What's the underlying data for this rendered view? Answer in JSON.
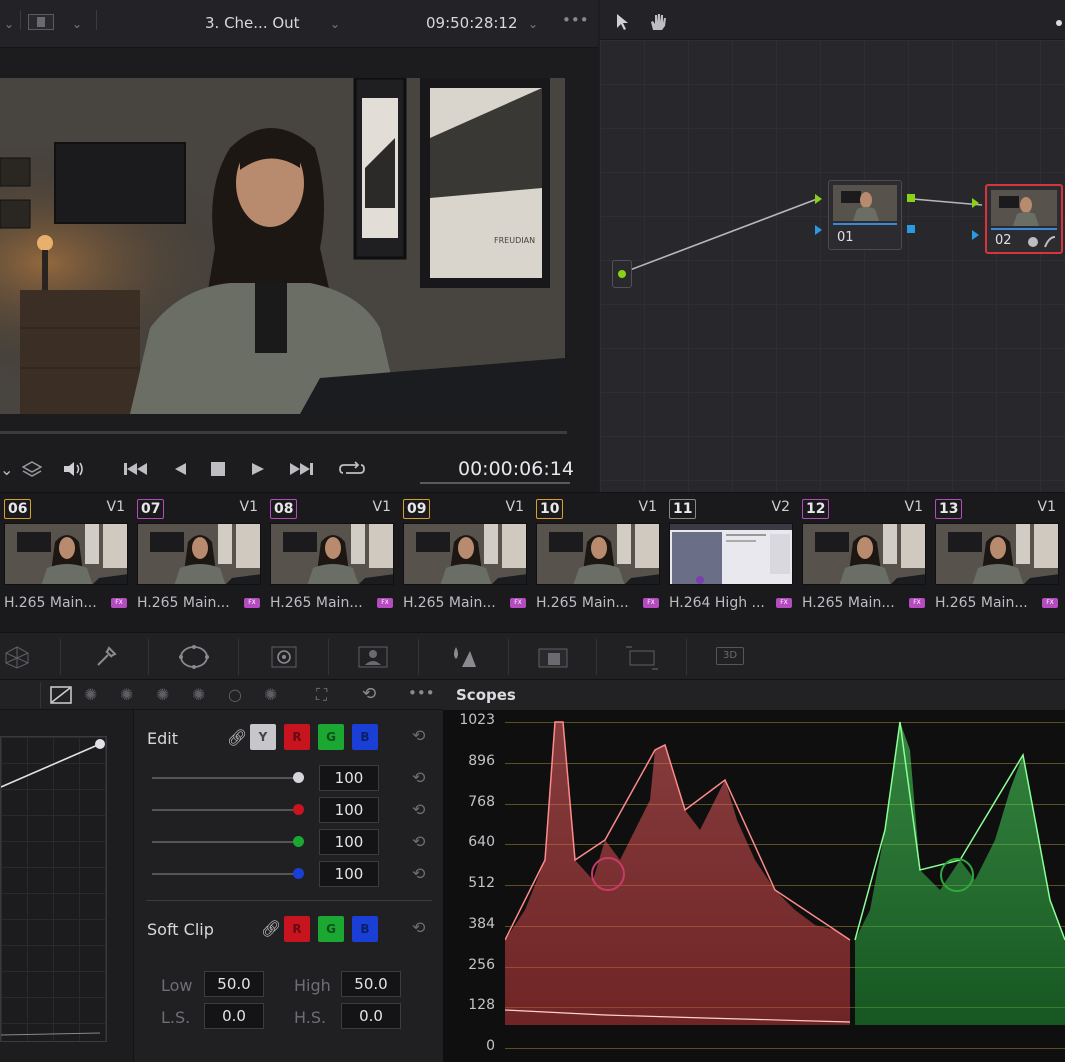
{
  "viewer": {
    "clip_name": "3. Che... Out",
    "timecode_top": "09:50:28:12",
    "more": "•••",
    "timecode": "00:00:06:14"
  },
  "nodes": [
    {
      "label": "01"
    },
    {
      "label": "02"
    }
  ],
  "clips": [
    {
      "num": "06",
      "track": "V1",
      "codec": "H.265 Main...",
      "color": "#d9a12a"
    },
    {
      "num": "07",
      "track": "V1",
      "codec": "H.265 Main...",
      "color": "#b44cc0"
    },
    {
      "num": "08",
      "track": "V1",
      "codec": "H.265 Main...",
      "color": "#b44cc0"
    },
    {
      "num": "09",
      "track": "V1",
      "codec": "H.265 Main...",
      "color": "#d9a12a"
    },
    {
      "num": "10",
      "track": "V1",
      "codec": "H.265 Main...",
      "color": "#d9a12a"
    },
    {
      "num": "11",
      "track": "V2",
      "codec": "H.264 High ...",
      "color": "#888888"
    },
    {
      "num": "12",
      "track": "V1",
      "codec": "H.265 Main...",
      "color": "#b44cc0"
    },
    {
      "num": "13",
      "track": "V1",
      "codec": "H.265 Main...",
      "color": "#b44cc0"
    }
  ],
  "fx_badge": "FX",
  "curves": {
    "edit_label": "Edit",
    "channels": [
      "Y",
      "R",
      "G",
      "B"
    ],
    "values": [
      "100",
      "100",
      "100",
      "100"
    ],
    "soft_clip_label": "Soft Clip",
    "soft_channels": [
      "R",
      "G",
      "B"
    ],
    "low_label": "Low",
    "low_value": "50.0",
    "high_label": "High",
    "high_value": "50.0",
    "ls_label": "L.S.",
    "ls_value": "0.0",
    "hs_label": "H.S.",
    "hs_value": "0.0"
  },
  "scopes": {
    "title": "Scopes",
    "scale": [
      "1023",
      "896",
      "768",
      "640",
      "512",
      "384",
      "256",
      "128",
      "0"
    ]
  },
  "colors": {
    "red": "#c8141e",
    "green": "#1aa832",
    "blue": "#1a3fd6",
    "accent_red": "#d8343a"
  }
}
